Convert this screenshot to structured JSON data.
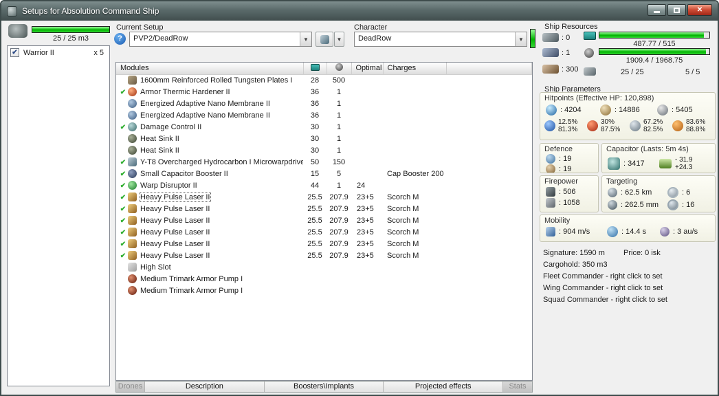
{
  "window": {
    "title": "Setups for Absolution Command Ship"
  },
  "drones_panel": {
    "capacity": "25 / 25 m3",
    "bar_fill": 100,
    "items": [
      {
        "name": "Warrior II",
        "qty": "x 5",
        "checked": true
      }
    ]
  },
  "setup": {
    "label": "Current Setup",
    "value": "PVP2/DeadRow"
  },
  "character": {
    "label": "Character",
    "value": "DeadRow"
  },
  "ship_resources": {
    "title": "Ship Resources",
    "turrets": ": 0",
    "launchers": ": 1",
    "calibration": ": 300",
    "cpu": "487.77 / 515",
    "powergrid": "1909.4 / 1968.75",
    "dronebay": "25 / 25",
    "drone_bandwidth": "5 / 5",
    "cpu_fill": 95,
    "powergrid_fill": 97
  },
  "modules": {
    "headers": {
      "name": "Modules",
      "optimal": "Optimal",
      "charges": "Charges"
    },
    "rows": [
      {
        "checked": false,
        "selected": false,
        "icon": "armor-plate-icon",
        "name": "1600mm Reinforced Rolled Tungsten Plates I",
        "cpu": "28",
        "pg": "500",
        "optimal": "",
        "charges": ""
      },
      {
        "checked": true,
        "selected": false,
        "icon": "armor-hardener-icon",
        "name": "Armor Thermic Hardener II",
        "cpu": "36",
        "pg": "1",
        "optimal": "",
        "charges": ""
      },
      {
        "checked": false,
        "selected": false,
        "icon": "nano-membrane-icon",
        "name": "Energized Adaptive Nano Membrane II",
        "cpu": "36",
        "pg": "1",
        "optimal": "",
        "charges": ""
      },
      {
        "checked": false,
        "selected": false,
        "icon": "nano-membrane-icon",
        "name": "Energized Adaptive Nano Membrane II",
        "cpu": "36",
        "pg": "1",
        "optimal": "",
        "charges": ""
      },
      {
        "checked": true,
        "selected": false,
        "icon": "damage-control-icon",
        "name": "Damage Control II",
        "cpu": "30",
        "pg": "1",
        "optimal": "",
        "charges": ""
      },
      {
        "checked": false,
        "selected": false,
        "icon": "heat-sink-icon",
        "name": "Heat Sink II",
        "cpu": "30",
        "pg": "1",
        "optimal": "",
        "charges": ""
      },
      {
        "checked": false,
        "selected": false,
        "icon": "heat-sink-icon",
        "name": "Heat Sink II",
        "cpu": "30",
        "pg": "1",
        "optimal": "",
        "charges": ""
      },
      {
        "checked": true,
        "selected": false,
        "icon": "mwd-icon",
        "name": "Y-T8 Overcharged Hydrocarbon I Microwarpdrive",
        "cpu": "50",
        "pg": "150",
        "optimal": "",
        "charges": ""
      },
      {
        "checked": true,
        "selected": false,
        "icon": "cap-booster-icon",
        "name": "Small Capacitor Booster II",
        "cpu": "15",
        "pg": "5",
        "optimal": "",
        "charges": "Cap Booster 200"
      },
      {
        "checked": true,
        "selected": false,
        "icon": "warp-disruptor-icon",
        "name": "Warp Disruptor II",
        "cpu": "44",
        "pg": "1",
        "optimal": "24",
        "charges": ""
      },
      {
        "checked": true,
        "selected": true,
        "icon": "pulse-laser-icon",
        "name": "Heavy Pulse Laser II",
        "cpu": "25.5",
        "pg": "207.9",
        "optimal": "23+5",
        "charges": "Scorch M"
      },
      {
        "checked": true,
        "selected": false,
        "icon": "pulse-laser-icon",
        "name": "Heavy Pulse Laser II",
        "cpu": "25.5",
        "pg": "207.9",
        "optimal": "23+5",
        "charges": "Scorch M"
      },
      {
        "checked": true,
        "selected": false,
        "icon": "pulse-laser-icon",
        "name": "Heavy Pulse Laser II",
        "cpu": "25.5",
        "pg": "207.9",
        "optimal": "23+5",
        "charges": "Scorch M"
      },
      {
        "checked": true,
        "selected": false,
        "icon": "pulse-laser-icon",
        "name": "Heavy Pulse Laser II",
        "cpu": "25.5",
        "pg": "207.9",
        "optimal": "23+5",
        "charges": "Scorch M"
      },
      {
        "checked": true,
        "selected": false,
        "icon": "pulse-laser-icon",
        "name": "Heavy Pulse Laser II",
        "cpu": "25.5",
        "pg": "207.9",
        "optimal": "23+5",
        "charges": "Scorch M"
      },
      {
        "checked": true,
        "selected": false,
        "icon": "pulse-laser-icon",
        "name": "Heavy Pulse Laser II",
        "cpu": "25.5",
        "pg": "207.9",
        "optimal": "23+5",
        "charges": "Scorch M"
      },
      {
        "checked": false,
        "selected": false,
        "icon": "empty-slot-icon",
        "name": "High Slot",
        "cpu": "",
        "pg": "",
        "optimal": "",
        "charges": ""
      },
      {
        "checked": false,
        "selected": false,
        "icon": "rig-icon",
        "name": "Medium Trimark Armor Pump I",
        "cpu": "",
        "pg": "",
        "optimal": "",
        "charges": ""
      },
      {
        "checked": false,
        "selected": false,
        "icon": "rig-icon",
        "name": "Medium Trimark Armor Pump I",
        "cpu": "",
        "pg": "",
        "optimal": "",
        "charges": ""
      }
    ]
  },
  "parameters": {
    "title": "Ship Parameters",
    "hitpoints": {
      "title": "Hitpoints (Effective HP: 120,898)",
      "shield": ": 4204",
      "armor": ": 14886",
      "hull": ": 5405",
      "resists": [
        {
          "type": "em",
          "shield": "12.5%",
          "armor": "81.3%"
        },
        {
          "type": "thermal",
          "shield": "30%",
          "armor": "87.5%"
        },
        {
          "type": "kinetic",
          "shield": "67.2%",
          "armor": "82.5%"
        },
        {
          "type": "explosive",
          "shield": "83.6%",
          "armor": "88.8%"
        }
      ]
    },
    "defence": {
      "title": "Defence",
      "value1": ": 19",
      "value2": ": 19"
    },
    "capacitor": {
      "title": "Capacitor (Lasts: 5m 4s)",
      "amount": ": 3417",
      "usage": "- 31.9",
      "recharge": "+24.3"
    },
    "firepower": {
      "title": "Firepower",
      "volley": ": 506",
      "dps": ": 1058"
    },
    "targeting": {
      "title": "Targeting",
      "range": ": 62.5 km",
      "max_targets": ": 6",
      "resolution": ": 262.5 mm",
      "sensor_strength": ": 16"
    },
    "mobility": {
      "title": "Mobility",
      "speed": ": 904 m/s",
      "agility": ": 14.4 s",
      "warp_speed": ": 3 au/s"
    },
    "info": {
      "signature": "Signature: 1590 m",
      "price": "Price: 0 isk",
      "cargohold": "Cargohold: 350 m3",
      "fleet": "Fleet Commander - right click to set",
      "wing": "Wing Commander - right click to set",
      "squad": "Squad Commander - right click to set"
    }
  },
  "bottom_tabs": [
    {
      "label": "Drones",
      "disabled": true
    },
    {
      "label": "Description",
      "disabled": false
    },
    {
      "label": "Boosters\\Implants",
      "disabled": false
    },
    {
      "label": "Projected effects",
      "disabled": false
    },
    {
      "label": "Stats",
      "disabled": true
    }
  ]
}
